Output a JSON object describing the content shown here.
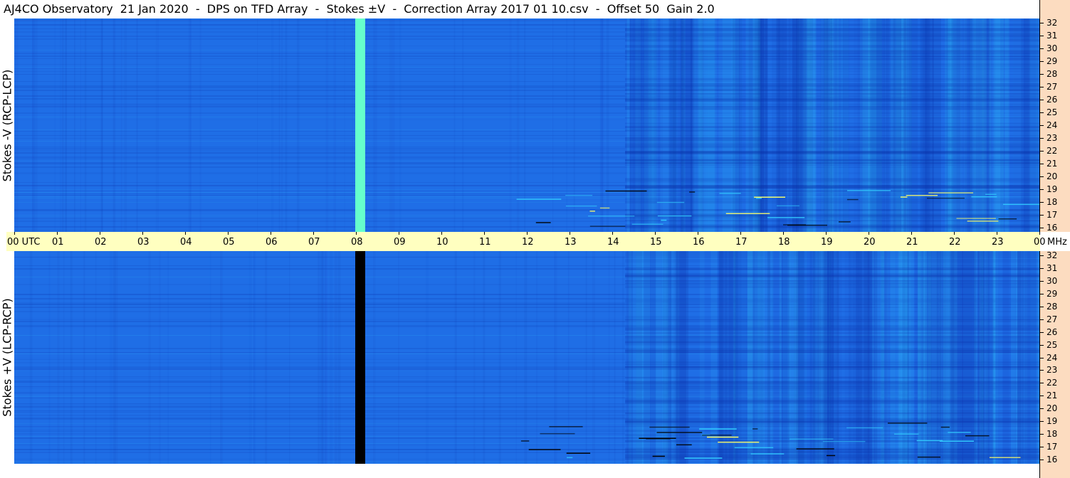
{
  "title": "AJ4CO Observatory  21 Jan 2020  -  DPS on TFD Array  -  Stokes ±V  -  Correction Array 2017 01 10.csv  -  Offset 50  Gain 2.0",
  "chart_data": {
    "type": "heatmap",
    "panels": [
      {
        "name": "Stokes -V (RCP-LCP)",
        "label": "Stokes -V (RCP-LCP)"
      },
      {
        "name": "Stokes +V (LCP-RCP)",
        "label": "Stokes +V (LCP-RCP)"
      }
    ],
    "x_ticks": [
      "00 UTC",
      "01",
      "02",
      "03",
      "04",
      "05",
      "06",
      "07",
      "08",
      "09",
      "10",
      "11",
      "12",
      "13",
      "14",
      "15",
      "16",
      "17",
      "18",
      "19",
      "20",
      "21",
      "22",
      "23",
      "00"
    ],
    "x_unit": "UTC",
    "y_ticks": [
      "32",
      "31",
      "30",
      "29",
      "28",
      "27",
      "26",
      "25",
      "24",
      "23",
      "22",
      "21",
      "20",
      "19",
      "18",
      "17",
      "16"
    ],
    "y_unit": "MHz",
    "y_range": [
      16,
      32
    ],
    "x_range_hours": [
      0,
      24
    ],
    "colors": {
      "background": "#1f6ee6",
      "dark": "#0a2fa8",
      "bright": "#33ccff",
      "top_stripe": "#66ffcc",
      "bottom_stripe": "#000000"
    },
    "features": [
      {
        "panel": 0,
        "type": "vertical_stripe",
        "utc_hour": 8.1,
        "color": "#66ffcc"
      },
      {
        "panel": 1,
        "type": "vertical_stripe",
        "utc_hour": 8.1,
        "color": "#000000"
      }
    ]
  }
}
